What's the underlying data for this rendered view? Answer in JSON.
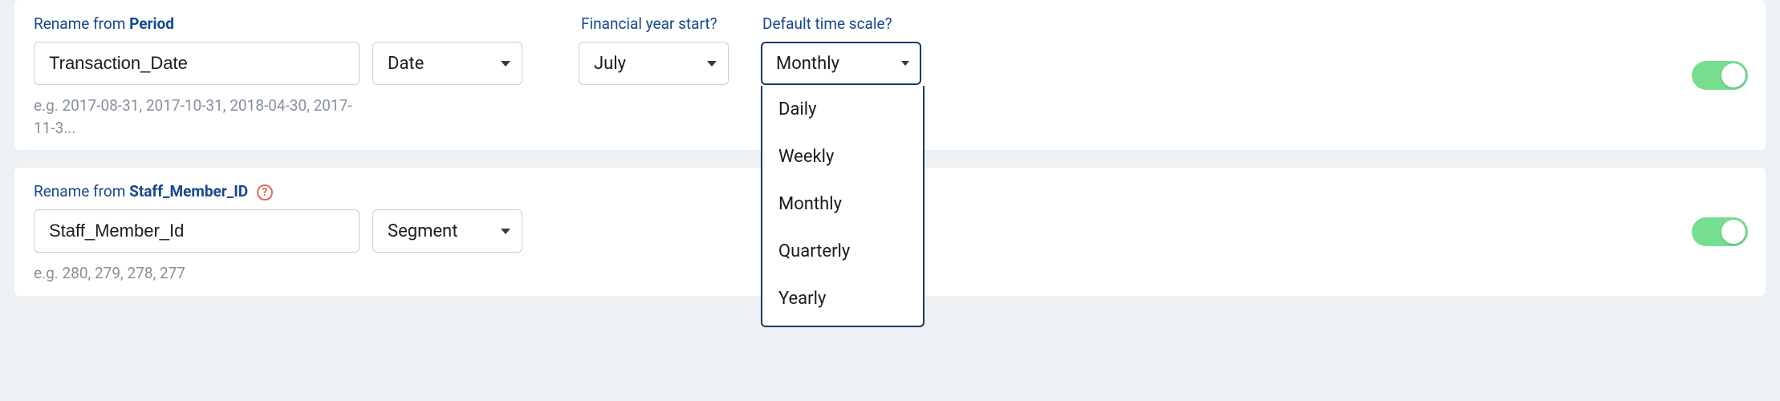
{
  "row1": {
    "rename_prefix": "Rename from ",
    "rename_from": "Period",
    "header_fy": "Financial year start?",
    "header_ts": "Default time scale?",
    "input_value": "Transaction_Date",
    "type_value": "Date",
    "fy_value": "July",
    "ts_value": "Monthly",
    "ts_options": [
      "Daily",
      "Weekly",
      "Monthly",
      "Quarterly",
      "Yearly"
    ],
    "hint": "e.g. 2017-08-31, 2017-10-31, 2018-04-30, 2017-11-3...",
    "toggle_on": true
  },
  "row2": {
    "rename_prefix": "Rename from ",
    "rename_from": "Staff_Member_ID",
    "input_value": "Staff_Member_Id",
    "type_value": "Segment",
    "hint": "e.g. 280, 279, 278, 277",
    "toggle_on": true,
    "help_glyph": "?"
  }
}
